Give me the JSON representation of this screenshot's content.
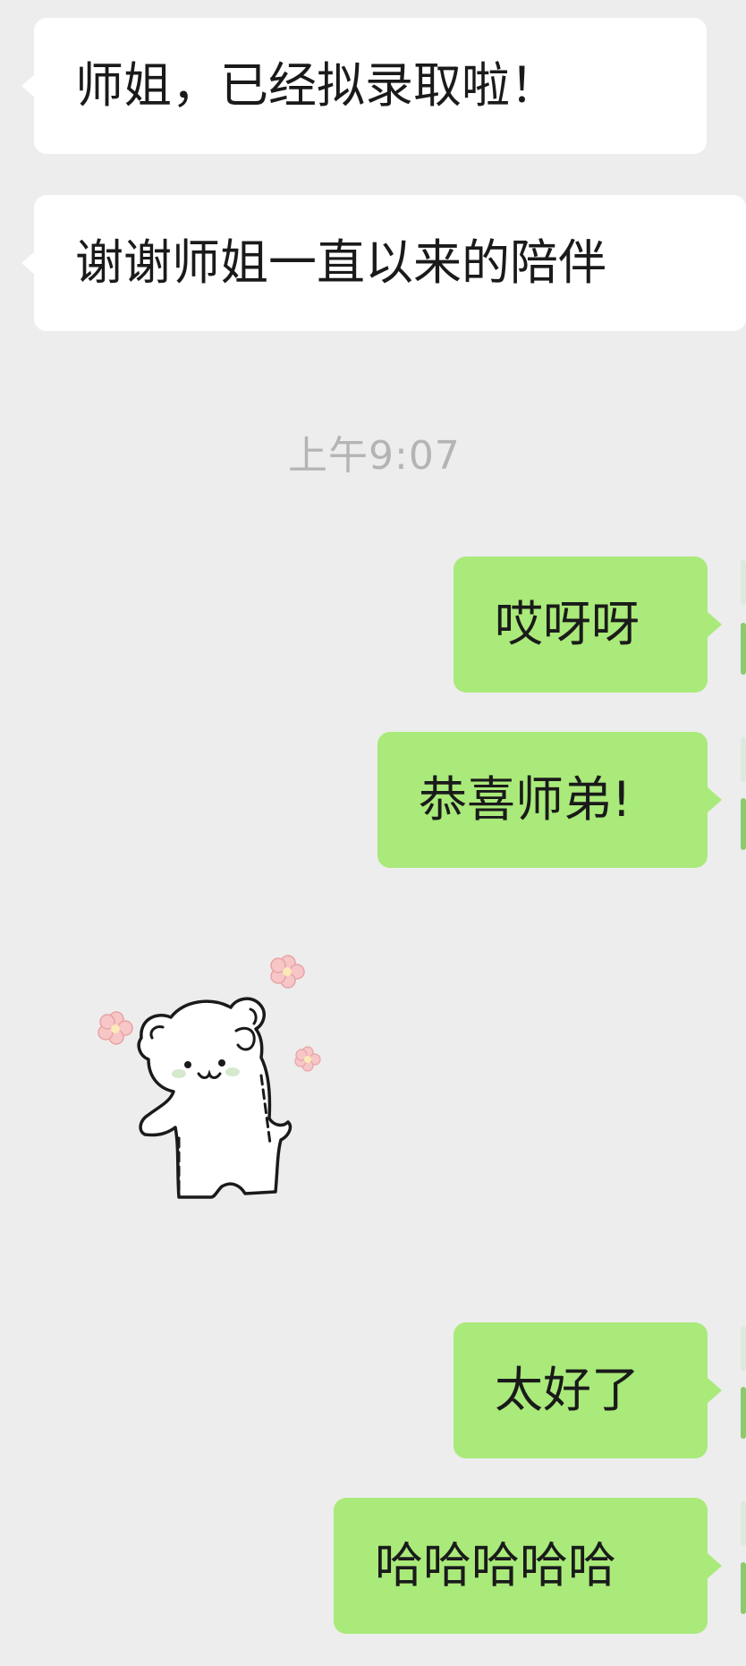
{
  "chat": {
    "timestamp": "上午9:07",
    "messages": [
      {
        "sender": "contact",
        "text": "师姐，已经拟录取啦！"
      },
      {
        "sender": "contact",
        "text": "谢谢师姐一直以来的陪伴"
      },
      {
        "sender": "me",
        "text": "哎呀呀"
      },
      {
        "sender": "me",
        "text": "恭喜师弟!"
      },
      {
        "sender": "contact",
        "type": "sticker",
        "icon": "bear-sticker"
      },
      {
        "sender": "me",
        "text": "太好了"
      },
      {
        "sender": "me",
        "text": "哈哈哈哈哈"
      }
    ]
  },
  "colors": {
    "background": "#ededed",
    "incoming_bubble": "#ffffff",
    "outgoing_bubble": "#a9ea7a",
    "timestamp": "#b4b4b4",
    "text": "#1a1a1a"
  }
}
